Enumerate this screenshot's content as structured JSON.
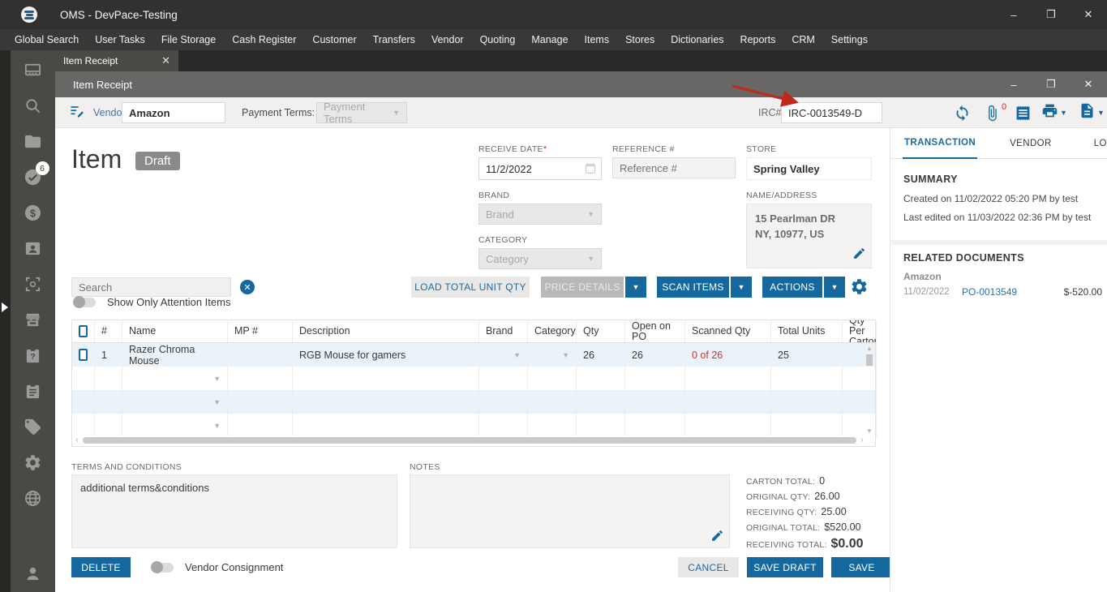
{
  "app": {
    "title": "OMS - DevPace-Testing"
  },
  "window_controls": {
    "minimize": "–",
    "maximize": "❐",
    "close": "✕"
  },
  "menu": {
    "items": [
      "Global Search",
      "User Tasks",
      "File Storage",
      "Cash Register",
      "Customer",
      "Transfers",
      "Vendor",
      "Quoting",
      "Manage",
      "Items",
      "Stores",
      "Dictionaries",
      "Reports",
      "CRM",
      "Settings"
    ]
  },
  "sidebar": {
    "badge_count": "6",
    "icons": [
      "pos-display",
      "search",
      "folder",
      "tasks-check",
      "dollar",
      "contact-card",
      "scan-frame",
      "store",
      "clipboard-question",
      "clipboard-list",
      "tag",
      "gear",
      "globe",
      "user"
    ]
  },
  "tab": {
    "label": "Item Receipt"
  },
  "inner_window": {
    "title": "Item Receipt"
  },
  "toolbar": {
    "vendor_label": "Vendor:",
    "vendor_value": "Amazon",
    "payment_terms_label": "Payment Terms:",
    "payment_terms_placeholder": "Payment Terms",
    "irc_label": "IRC#",
    "irc_value": "IRC-0013549-D",
    "attachment_count": "0",
    "icons": [
      "sync",
      "paperclip",
      "receipt",
      "printer",
      "export-doc"
    ]
  },
  "doc_header": {
    "title": "Item",
    "status_badge": "Draft"
  },
  "form": {
    "receive_date": {
      "label": "RECEIVE DATE",
      "required_mark": "*",
      "value": "11/2/2022"
    },
    "reference": {
      "label": "REFERENCE #",
      "placeholder": "Reference #"
    },
    "store": {
      "label": "STORE",
      "value": "Spring Valley"
    },
    "brand": {
      "label": "BRAND",
      "placeholder": "Brand"
    },
    "category": {
      "label": "CATEGORY",
      "placeholder": "Category"
    },
    "name_address": {
      "label": "NAME/ADDRESS",
      "line1": "15 Pearlman DR",
      "line2": "NY, 10977, US"
    }
  },
  "items_toolbar": {
    "search_placeholder": "Search",
    "attention_toggle_label": "Show Only Attention Items",
    "load_total_label": "LOAD TOTAL UNIT QTY",
    "price_details_label": "PRICE DETAILS",
    "scan_items_label": "SCAN ITEMS",
    "actions_label": "ACTIONS"
  },
  "table": {
    "headers": [
      "#",
      "Name",
      "MP #",
      "Description",
      "Brand",
      "Category",
      "Qty",
      "Open on PO",
      "Scanned Qty",
      "Total Units",
      "Qty Per Carton"
    ],
    "row1": {
      "num": "1",
      "name": "Razer Chroma Mouse",
      "mp": "",
      "description": "RGB Mouse for gamers",
      "qty": "26",
      "open_on_po": "26",
      "scanned_qty": "0 of 26",
      "total_units": "25"
    }
  },
  "bottom": {
    "terms_label": "TERMS AND CONDITIONS",
    "terms_value": "additional terms&conditions",
    "notes_label": "NOTES",
    "notes_value": ""
  },
  "totals": [
    {
      "label": "CARTON TOTAL:",
      "value": "0"
    },
    {
      "label": "ORIGINAL QTY:",
      "value": "26.00"
    },
    {
      "label": "RECEIVING QTY:",
      "value": "25.00"
    },
    {
      "label": "ORIGINAL TOTAL:",
      "value": "$520.00"
    },
    {
      "label": "RECEIVING TOTAL:",
      "value": "$0.00"
    }
  ],
  "footer": {
    "delete_label": "DELETE",
    "consignment_label": "Vendor Consignment",
    "cancel_label": "CANCEL",
    "save_draft_label": "SAVE DRAFT",
    "save_label": "SAVE"
  },
  "right_panel": {
    "tabs": [
      "TRANSACTION",
      "VENDOR",
      "LOGS"
    ],
    "summary": {
      "heading": "SUMMARY",
      "created_line": "Created on 11/02/2022 05:20 PM by test",
      "edited_line": "Last edited on 11/03/2022 02:36 PM by test"
    },
    "related": {
      "heading": "RELATED DOCUMENTS",
      "vendor": "Amazon",
      "date": "11/02/2022",
      "doc_link": "PO-0013549",
      "amount": "$-520.00"
    }
  },
  "colors": {
    "accent_blue": "#15689e",
    "link_blue": "#1f73ad",
    "alert_red": "#d1342e",
    "badge_gray": "#8b8a88"
  }
}
